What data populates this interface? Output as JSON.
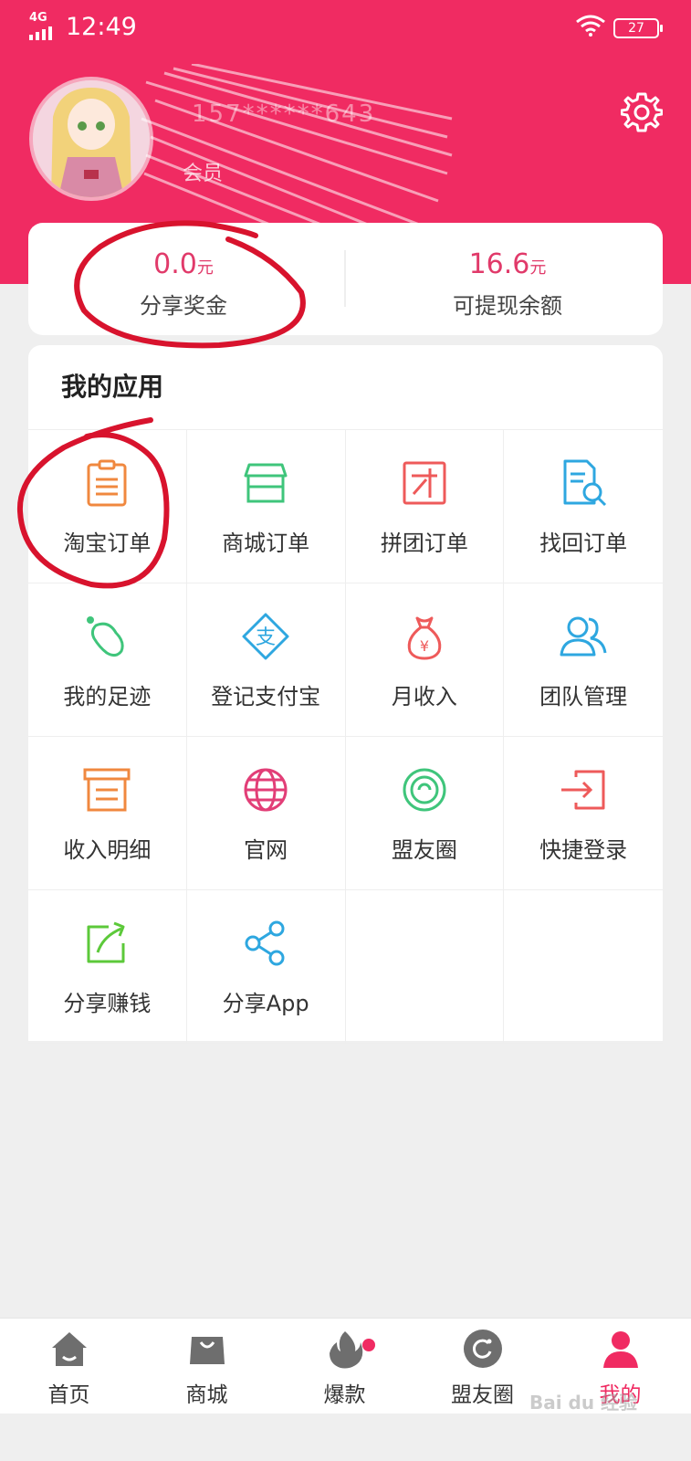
{
  "status_bar": {
    "network": "4G",
    "time": "12:49",
    "battery": "27"
  },
  "profile": {
    "username": "157******643",
    "member_label": "会员",
    "icons": {
      "settings": "gear-icon"
    }
  },
  "balances": {
    "share_bonus": {
      "value": "0.0",
      "unit": "元",
      "label": "分享奖金"
    },
    "withdrawable": {
      "value": "16.6",
      "unit": "元",
      "label": "可提现余额"
    }
  },
  "apps": {
    "title": "我的应用",
    "items": [
      {
        "label": "淘宝订单",
        "icon": "clipboard-icon",
        "color": "#f0883f"
      },
      {
        "label": "商城订单",
        "icon": "store-icon",
        "color": "#3fc57b"
      },
      {
        "label": "拼团订单",
        "icon": "group-buy-icon",
        "color": "#ee5a5a"
      },
      {
        "label": "找回订单",
        "icon": "document-search-icon",
        "color": "#2ea7e0"
      },
      {
        "label": "我的足迹",
        "icon": "footprint-icon",
        "color": "#3fc57b"
      },
      {
        "label": "登记支付宝",
        "icon": "alipay-icon",
        "color": "#2ea7e0"
      },
      {
        "label": "月收入",
        "icon": "money-bag-icon",
        "color": "#ee5a5a"
      },
      {
        "label": "团队管理",
        "icon": "team-icon",
        "color": "#2ea7e0"
      },
      {
        "label": "收入明细",
        "icon": "archive-box-icon",
        "color": "#f0883f"
      },
      {
        "label": "官网",
        "icon": "globe-icon",
        "color": "#e23e77"
      },
      {
        "label": "盟友圈",
        "icon": "circle-target-icon",
        "color": "#3fc57b"
      },
      {
        "label": "快捷登录",
        "icon": "login-icon",
        "color": "#ee5a5a"
      },
      {
        "label": "分享赚钱",
        "icon": "share-arrow-icon",
        "color": "#5cc93a"
      },
      {
        "label": "分享App",
        "icon": "share-nodes-icon",
        "color": "#2ea7e0"
      }
    ]
  },
  "bottom_nav": {
    "items": [
      {
        "label": "首页",
        "icon": "home-icon"
      },
      {
        "label": "商城",
        "icon": "shopping-bag-icon"
      },
      {
        "label": "爆款",
        "icon": "flame-icon"
      },
      {
        "label": "盟友圈",
        "icon": "circle-icon"
      },
      {
        "label": "我的",
        "icon": "person-icon"
      }
    ],
    "active_index": 4
  },
  "watermark": "Bai du 经验",
  "colors": {
    "brand": "#f02b62",
    "price": "#e13a6a",
    "annotation": "#d8132d"
  }
}
